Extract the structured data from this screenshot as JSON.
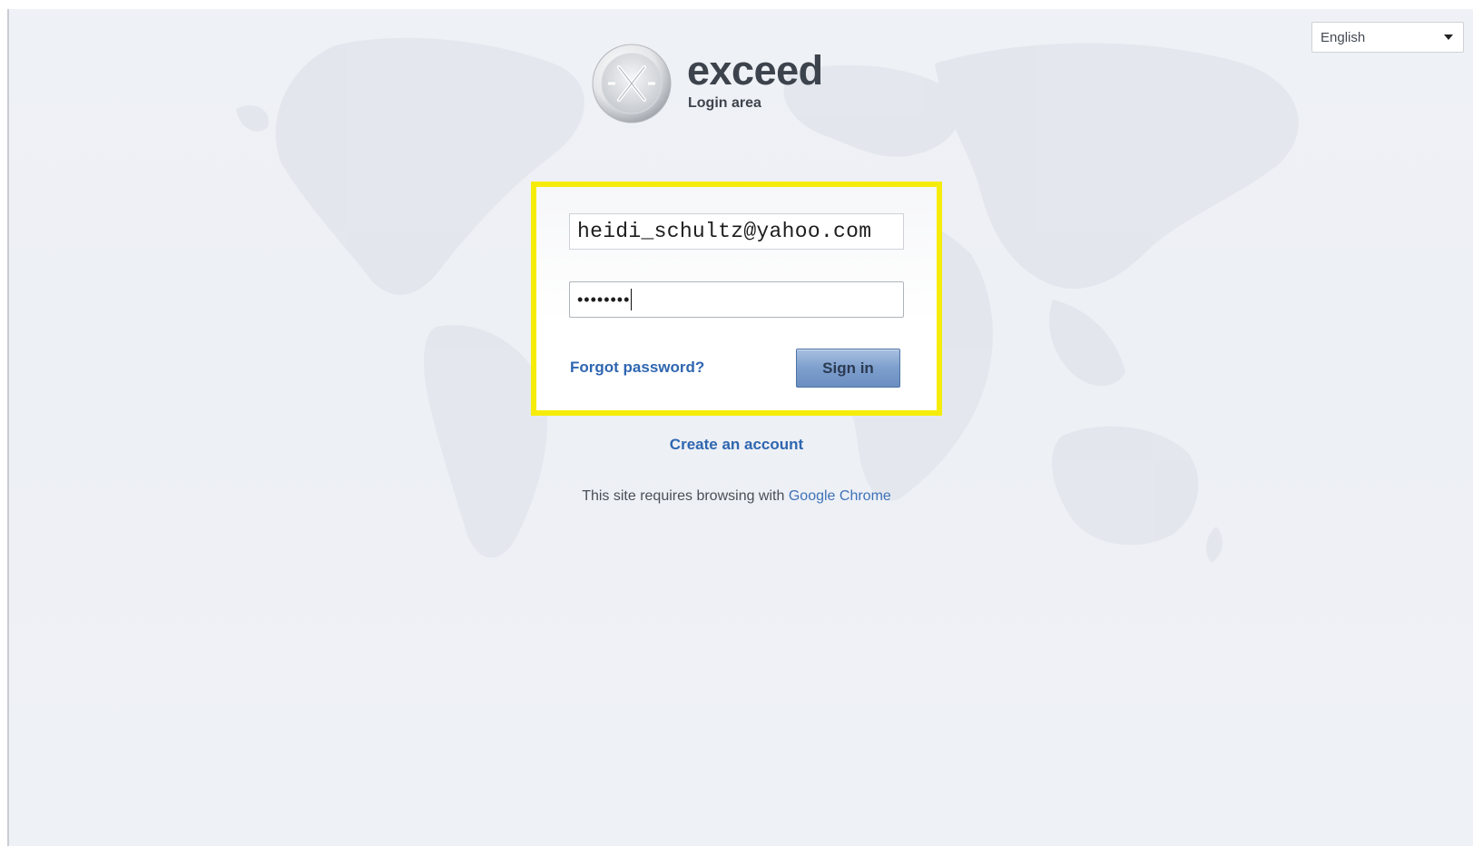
{
  "header": {
    "language": "English",
    "brand_name": "exceed",
    "brand_subtitle": "Login area"
  },
  "login_form": {
    "email_value": "heidi_schultz@yahoo.com",
    "password_masked": "••••••••",
    "forgot_label": "Forgot password?",
    "signin_label": "Sign in"
  },
  "footer": {
    "create_account_label": "Create an account",
    "requires_text": "This site requires browsing with",
    "chrome_link": "Google Chrome"
  },
  "colors": {
    "highlight_border": "#f6ec0c",
    "link": "#2f66b0",
    "button": "#7d9fcd"
  },
  "icons": [
    "chevron-down-icon",
    "exceed-logo"
  ]
}
